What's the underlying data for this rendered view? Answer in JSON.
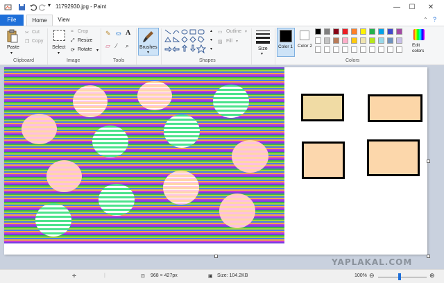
{
  "window": {
    "title": "11792930.jpg - Paint",
    "controls": {
      "minimize": "—",
      "maximize": "☐",
      "close": "✕"
    }
  },
  "tabs": [
    {
      "label": "File"
    },
    {
      "label": "Home"
    },
    {
      "label": "View"
    }
  ],
  "ribbon": {
    "clipboard": {
      "label": "Clipboard",
      "paste": "Paste",
      "cut": "Cut",
      "copy": "Copy"
    },
    "image": {
      "label": "Image",
      "select": "Select",
      "crop": "Crop",
      "resize": "Resize",
      "rotate": "Rotate"
    },
    "tools": {
      "label": "Tools",
      "text_tool": "A"
    },
    "brushes": {
      "label": "Brushes"
    },
    "shapes": {
      "label": "Shapes",
      "outline": "Outline",
      "fill": "Fill"
    },
    "size": {
      "label": "Size"
    },
    "colors": {
      "label": "Colors",
      "color1": "Color 1",
      "color2": "Color 2",
      "edit": "Edit colors",
      "color1_value": "#000000",
      "color2_value": "#ffffff",
      "palette_row1": [
        "#000000",
        "#7f7f7f",
        "#880015",
        "#ed1c24",
        "#ff7f27",
        "#fff200",
        "#22b14c",
        "#00a2e8",
        "#3f48cc",
        "#a349a4"
      ],
      "palette_row2": [
        "#ffffff",
        "#c3c3c3",
        "#b97a57",
        "#ffaec9",
        "#ffc90e",
        "#efe4b0",
        "#b5e61d",
        "#99d9ea",
        "#7092be",
        "#c8bfe7"
      ],
      "palette_row3": [
        "#ffffff",
        "#ffffff",
        "#ffffff",
        "#ffffff",
        "#ffffff",
        "#ffffff",
        "#ffffff",
        "#ffffff",
        "#ffffff",
        "#ffffff"
      ]
    }
  },
  "watermark": "YAPLAKAL.COM",
  "status": {
    "dimensions": "968 × 427px",
    "size": "Size: 104.2KB",
    "zoom": "100%"
  }
}
